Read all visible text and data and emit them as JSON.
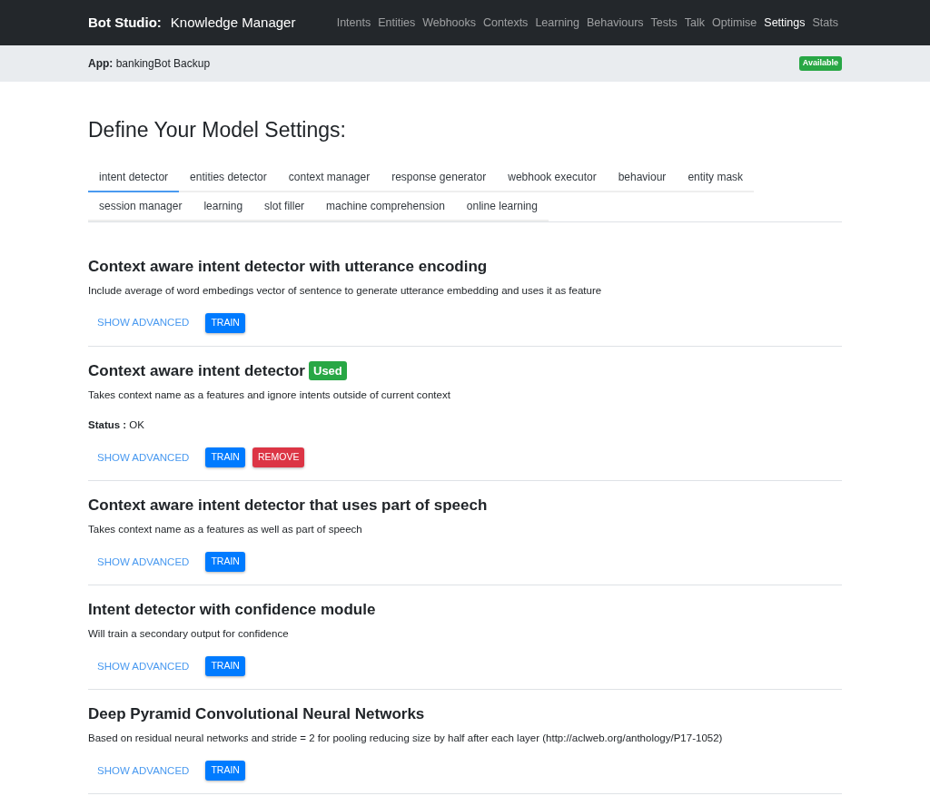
{
  "navbar": {
    "brand": "Bot Studio:",
    "subtitle": "Knowledge Manager",
    "items": [
      {
        "label": "Intents",
        "selected": false
      },
      {
        "label": "Entities",
        "selected": false
      },
      {
        "label": "Webhooks",
        "selected": false
      },
      {
        "label": "Contexts",
        "selected": false
      },
      {
        "label": "Learning",
        "selected": false
      },
      {
        "label": "Behaviours",
        "selected": false
      },
      {
        "label": "Tests",
        "selected": false
      },
      {
        "label": "Talk",
        "selected": false
      },
      {
        "label": "Optimise",
        "selected": false
      },
      {
        "label": "Settings",
        "selected": true
      },
      {
        "label": "Stats",
        "selected": false
      }
    ]
  },
  "app_bar": {
    "app": "**App:** bankingBot Backup",
    "badge": "Available"
  },
  "heading": "Define Your Model Settings:",
  "tabs": [
    {
      "label": "intent detector",
      "selected": true
    },
    {
      "label": "entities detector",
      "selected": false
    },
    {
      "label": "context manager",
      "selected": false
    },
    {
      "label": "response generator",
      "selected": false
    },
    {
      "label": "webhook executor",
      "selected": false
    },
    {
      "label": "behaviour",
      "selected": false
    },
    {
      "label": "entity mask",
      "selected": false
    },
    {
      "label": "session manager",
      "selected": false
    },
    {
      "label": "learning",
      "selected": false
    },
    {
      "label": "slot filler",
      "selected": false
    },
    {
      "label": "machine comprehension",
      "selected": false
    },
    {
      "label": "online learning",
      "selected": false
    }
  ],
  "models": [
    {
      "title": "Context aware intent detector with utterance encoding",
      "description": "Include average of word embedings vector of sentence to generate utterance embedding and uses it as feature",
      "buttons": [
        {
          "kind": "link",
          "label": "SHOW ADVANCED"
        },
        {
          "kind": "primary",
          "label": "TRAIN"
        }
      ]
    },
    {
      "title": "Context aware intent detector",
      "badge": "Used",
      "description": "Takes context name as a features and ignore intents outside of current context",
      "status": "**Status :** OK",
      "buttons": [
        {
          "kind": "link",
          "label": "SHOW ADVANCED"
        },
        {
          "kind": "primary",
          "label": "TRAIN"
        },
        {
          "kind": "danger",
          "label": "REMOVE"
        }
      ]
    },
    {
      "title": "Context aware intent detector that uses part of speech",
      "description": "Takes context name as a features as well as part of speech",
      "buttons": [
        {
          "kind": "link",
          "label": "SHOW ADVANCED"
        },
        {
          "kind": "primary",
          "label": "TRAIN"
        }
      ]
    },
    {
      "title": "Intent detector with confidence module",
      "description": "Will train a secondary output for confidence",
      "buttons": [
        {
          "kind": "link",
          "label": "SHOW ADVANCED"
        },
        {
          "kind": "primary",
          "label": "TRAIN"
        }
      ]
    },
    {
      "title": "Deep Pyramid Convolutional Neural Networks",
      "description": "Based on residual neural networks and stride = 2 for pooling reducing size by half after each layer (http://aclweb.org/anthology/P17-1052)",
      "buttons": [
        {
          "kind": "link",
          "label": "SHOW ADVANCED"
        },
        {
          "kind": "primary",
          "label": "TRAIN"
        }
      ]
    }
  ]
}
